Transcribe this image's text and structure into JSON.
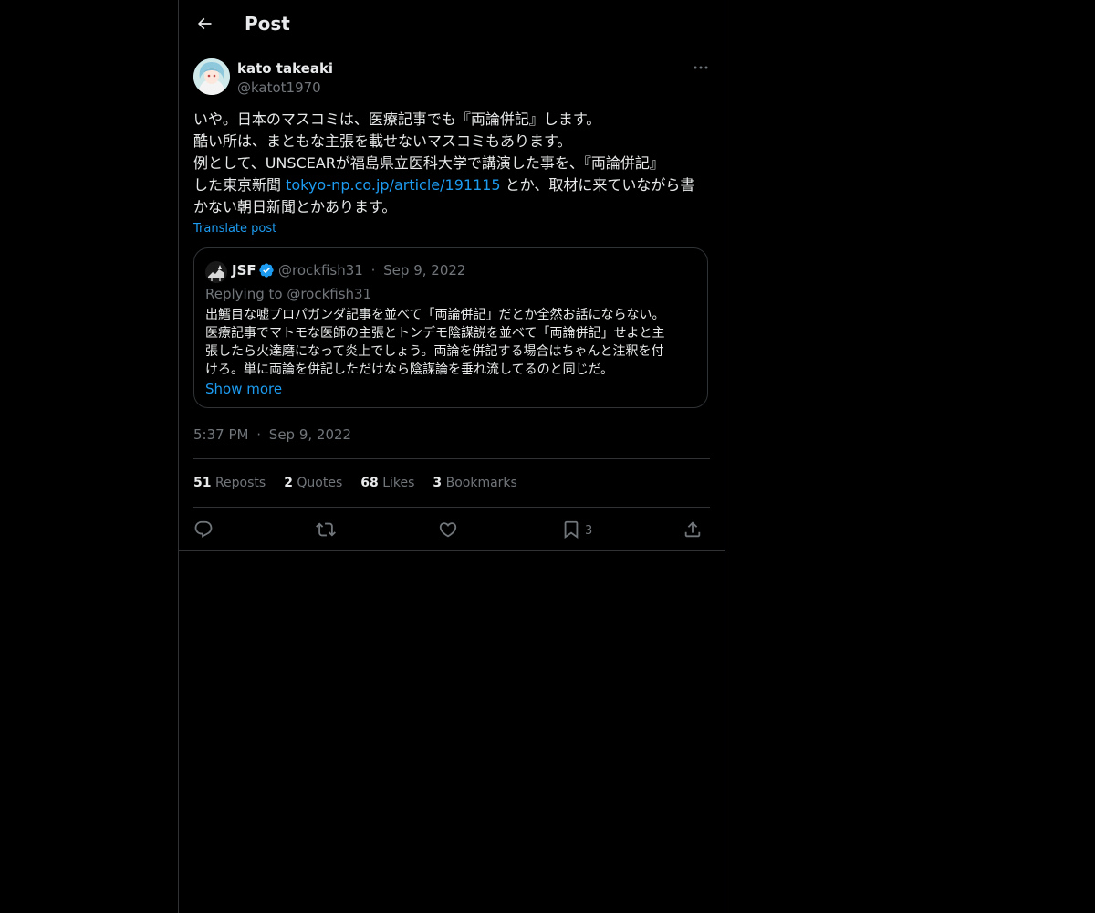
{
  "header": {
    "title": "Post"
  },
  "author": {
    "name": "kato takeaki",
    "handle": "@katot1970"
  },
  "post": {
    "line1": "いや。日本のマスコミは、医療記事でも『両論併記』します。",
    "line2": "酷い所は、まともな主張を載せないマスコミもあります。",
    "line3": "例として、UNSCEARが福島県立医科大学で講演した事を、『両論併記』",
    "line4_before": "した東京新聞 ",
    "line4_link": "tokyo-np.co.jp/article/191115",
    "line4_after": " とか、取材に来ていながら書",
    "line5": "かない朝日新聞とかあります。",
    "translate": "Translate post"
  },
  "quote": {
    "name": "JSF",
    "handle": "@rockfish31",
    "date": "Sep 9, 2022",
    "replying": "Replying to @rockfish31",
    "lines": [
      "出鱈目な嘘プロパガンダ記事を並べて「両論併記」だとか全然お話にならない。",
      "医療記事でマトモな医師の主張とトンデモ陰謀説を並べて「両論併記」せよと主",
      "張したら火達磨になって炎上でしょう。両論を併記する場合はちゃんと注釈を付",
      "けろ。単に両論を併記しただけなら陰謀論を垂れ流してるのと同じだ。"
    ],
    "show_more": "Show more"
  },
  "meta": {
    "time": "5:37 PM",
    "separator": "·",
    "date": "Sep 9, 2022"
  },
  "stats": {
    "reposts_count": "51",
    "reposts_label": "Reposts",
    "quotes_count": "2",
    "quotes_label": "Quotes",
    "likes_count": "68",
    "likes_label": "Likes",
    "bookmarks_count": "3",
    "bookmarks_label": "Bookmarks"
  },
  "actions": {
    "reply_icon": "reply-icon",
    "repost_icon": "repost-icon",
    "like_icon": "heart-icon",
    "bookmark_icon": "bookmark-icon",
    "bookmark_count": "3",
    "share_icon": "share-icon"
  },
  "colors": {
    "background": "#000000",
    "text": "#e7e9ea",
    "muted": "#71767b",
    "accent": "#1d9bf0",
    "border": "#2f3336"
  }
}
